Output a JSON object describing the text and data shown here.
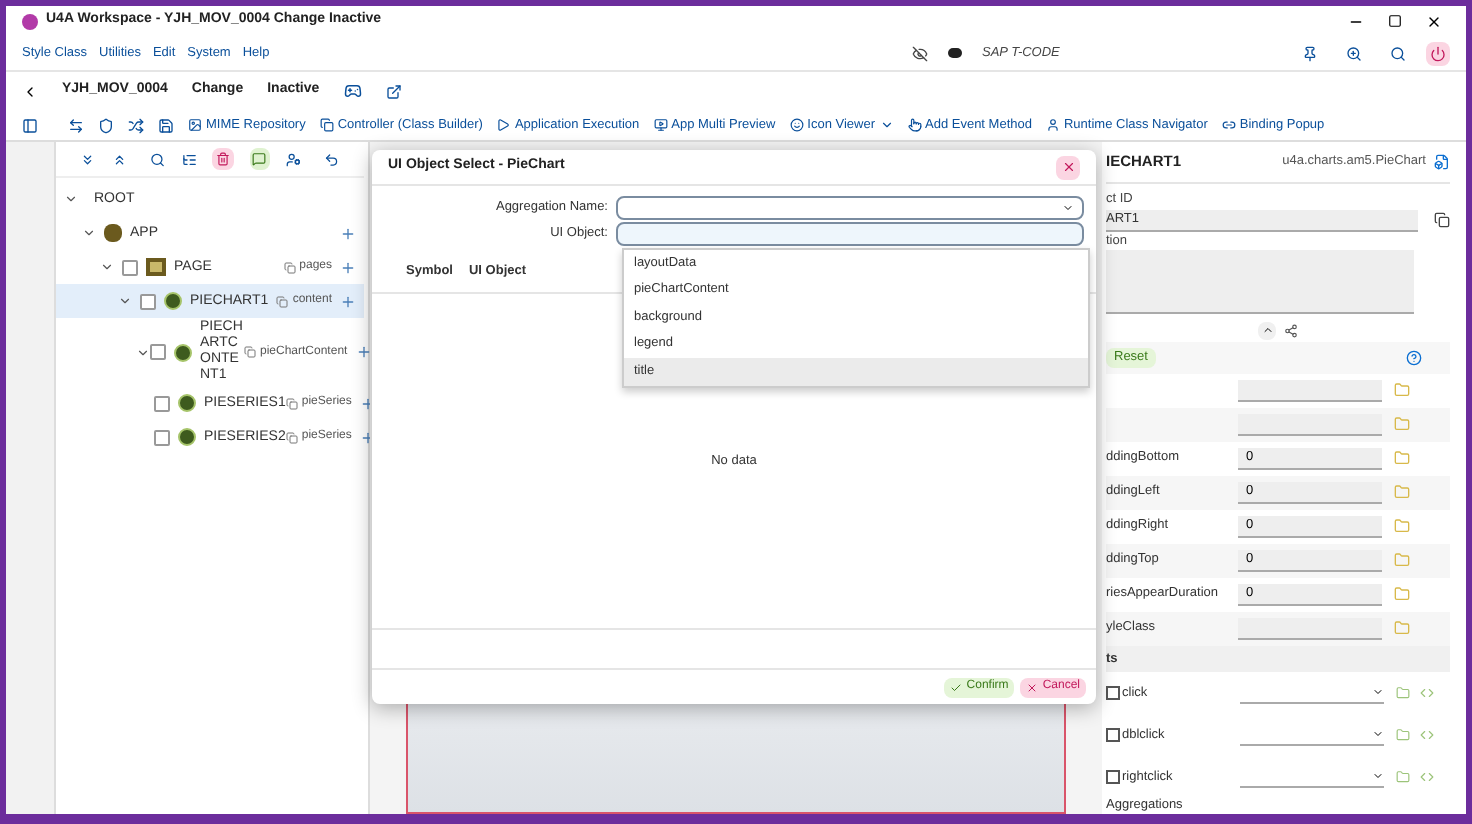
{
  "window": {
    "title": "U4A Workspace - YJH_MOV_0004 Change Inactive"
  },
  "menu": [
    "Style Class",
    "Utilities",
    "Edit",
    "System",
    "Help"
  ],
  "tcode": {
    "placeholder": "SAP T-CODE"
  },
  "header": {
    "app_id": "YJH_MOV_0004",
    "mode": "Change",
    "status": "Inactive"
  },
  "toolbar": [
    {
      "label": "MIME Repository",
      "kind": "image"
    },
    {
      "label": "Controller (Class Builder)",
      "kind": "copy"
    },
    {
      "label": "Application Execution",
      "kind": "play"
    },
    {
      "label": "App Multi Preview",
      "kind": "preview"
    },
    {
      "label": "Icon Viewer",
      "kind": "smile",
      "dropdown": true
    },
    {
      "label": "Add Event Method",
      "kind": "touch"
    },
    {
      "label": "Runtime Class Navigator",
      "kind": "user"
    },
    {
      "label": "Binding Popup",
      "kind": "link"
    }
  ],
  "tree": [
    {
      "name": "ROOT",
      "kind": "root",
      "expanded": true,
      "children": [
        {
          "name": "APP",
          "kind": "app",
          "expanded": true,
          "children": [
            {
              "name": "PAGE",
              "kind": "page",
              "checked": false,
              "aggregation": "pages",
              "expanded": true,
              "children": [
                {
                  "name": "PIECHART1",
                  "kind": "chart",
                  "checked": false,
                  "aggregation": "content",
                  "expanded": true,
                  "selected": true,
                  "children": [
                    {
                      "name": "PIECHARTCONTENT1",
                      "kind": "chart",
                      "checked": false,
                      "aggregation": "pieChartContent",
                      "expanded": true,
                      "selected": false,
                      "children": [
                        {
                          "name": "PIESERIES1",
                          "kind": "chart",
                          "checked": false,
                          "aggregation": "pieSeries",
                          "selected": false
                        },
                        {
                          "name": "PIESERIES2",
                          "kind": "chart",
                          "checked": false,
                          "aggregation": "pieSeries",
                          "selected": false
                        }
                      ]
                    }
                  ]
                }
              ]
            }
          ]
        }
      ]
    }
  ],
  "dialog": {
    "title": "UI Object Select - PieChart",
    "aggregation_label": "Aggregation Name:",
    "ui_object_label": "UI Object:",
    "columns": [
      "Symbol",
      "UI Object"
    ],
    "empty_text": "No data",
    "options": [
      {
        "label": "layoutData",
        "selected": false
      },
      {
        "label": "pieChartContent",
        "selected": false
      },
      {
        "label": "background",
        "selected": false
      },
      {
        "label": "legend",
        "selected": false
      },
      {
        "label": "title",
        "selected": true
      }
    ],
    "confirm": "Confirm",
    "cancel": "Cancel"
  },
  "properties": {
    "title": "IECHART1",
    "class_name": "u4a.charts.am5.PieChart",
    "id_label": "ct ID",
    "id_value": "ART1",
    "desc_label": "tion",
    "reset": "Reset",
    "rows": [
      {
        "label": null,
        "value": ""
      },
      {
        "label": null,
        "value": ""
      },
      {
        "label": "ddingBottom",
        "value": "0"
      },
      {
        "label": "ddingLeft",
        "value": "0"
      },
      {
        "label": "ddingRight",
        "value": "0"
      },
      {
        "label": "ddingTop",
        "value": "0"
      },
      {
        "label": "riesAppearDuration",
        "value": "0"
      },
      {
        "label": "yleClass",
        "value": ""
      }
    ],
    "events_label": "ts",
    "events": [
      {
        "label": "click",
        "checked": false
      },
      {
        "label": "dblclick",
        "checked": false
      },
      {
        "label": "rightclick",
        "checked": false
      }
    ],
    "aggregations_label": "Aggregations"
  }
}
